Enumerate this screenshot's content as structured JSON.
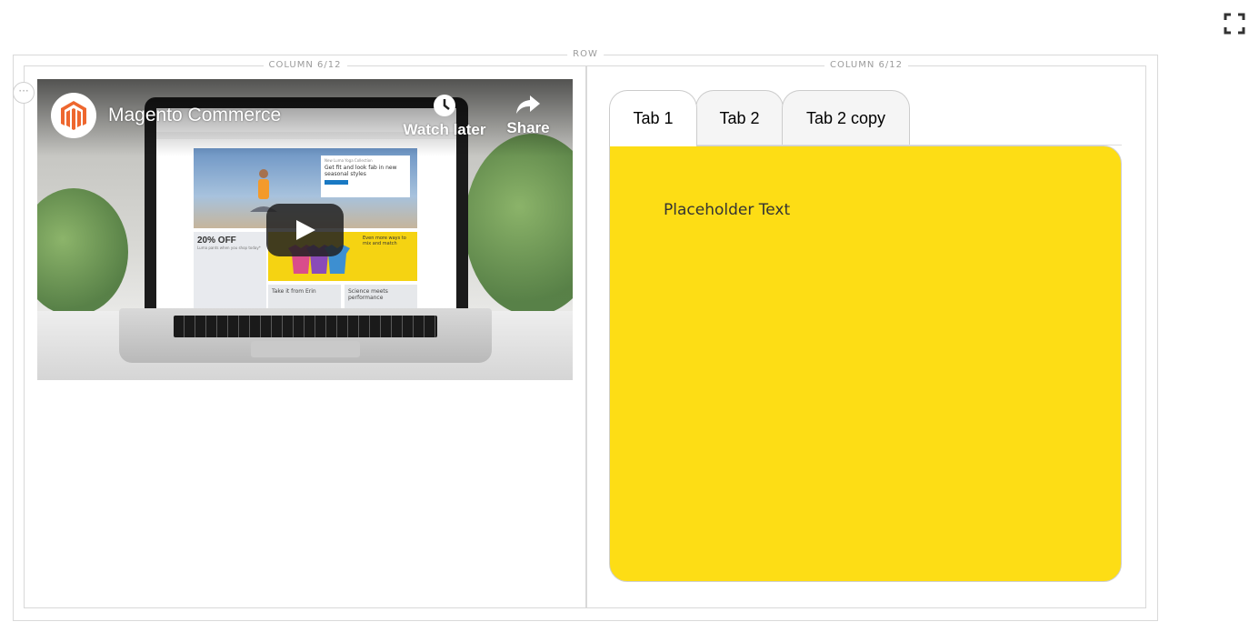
{
  "toolbar": {
    "fullscreen_icon": "fullscreen-icon"
  },
  "row": {
    "label": "ROW"
  },
  "columns": [
    {
      "label": "COLUMN 6/12"
    },
    {
      "label": "COLUMN 6/12"
    }
  ],
  "video": {
    "channel_icon": "magento-logo-icon",
    "title": "Magento Commerce",
    "watch_later_label": "Watch later",
    "share_label": "Share",
    "play_icon": "play-icon",
    "screen": {
      "hero_small": "New Luma Yoga Collection",
      "hero_headline": "Get fit and look fab in new seasonal styles",
      "promo_big": "20% OFF",
      "promo_small": "Luma pants when you shop today*",
      "promo_yellow": "Even more ways to mix and match",
      "promo_bottom_1": "Take it from Erin",
      "promo_bottom_2": "Science meets performance"
    }
  },
  "tabs": {
    "items": [
      {
        "label": "Tab 1",
        "active": true
      },
      {
        "label": "Tab 2",
        "active": false
      },
      {
        "label": "Tab 2 copy",
        "active": false
      }
    ],
    "panel": {
      "text": "Placeholder Text",
      "background": "#fddd15"
    }
  }
}
